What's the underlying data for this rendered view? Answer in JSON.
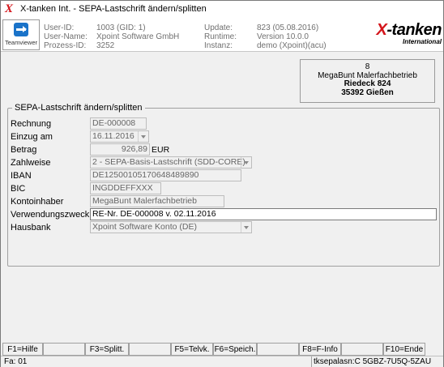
{
  "window": {
    "app_icon": "x-tanken-logo-icon",
    "app_icon_glyph": "X",
    "title": "X-tanken Int. - SEPA-Lastschrift ändern/splitten"
  },
  "header": {
    "teamviewer_label": "Teamviewer",
    "user_id_label": "User-ID:",
    "user_name_label": "User-Name:",
    "process_id_label": "Prozess-ID:",
    "user_id": "1003 (GID: 1)",
    "user_name": "Xpoint Software GmbH",
    "process_id": "3252",
    "update_label": "Update:",
    "runtime_label": "Runtime:",
    "instance_label": "Instanz:",
    "update": "823 (05.08.2016)",
    "runtime": "Version 10.0.0",
    "instance": "demo (Xpoint)(acu)",
    "brand_x": "X",
    "brand_rest": "-tanken",
    "brand_sub": "International"
  },
  "address": {
    "number": "8",
    "name": "MegaBunt Malerfachbetrieb",
    "street": "Riedeck 824",
    "city": "35392 Gießen"
  },
  "form": {
    "legend": "SEPA-Lastschrift ändern/splitten",
    "labels": {
      "rechnung": "Rechnung",
      "einzug": "Einzug am",
      "betrag": "Betrag",
      "zahlweise": "Zahlweise",
      "iban": "IBAN",
      "bic": "BIC",
      "kontoinhaber": "Kontoinhaber",
      "verwendungszweck": "Verwendungszweck",
      "hausbank": "Hausbank"
    },
    "values": {
      "rechnung": "DE-000008",
      "einzug": "16.11.2016",
      "betrag": "926,89",
      "currency": "EUR",
      "zahlweise": "2 - SEPA-Basis-Lastschrift (SDD-CORE)",
      "iban": "DE12500105170648489890",
      "bic": "INGDDEFFXXX",
      "kontoinhaber": "MegaBunt Malerfachbetrieb",
      "verwendungszweck": "RE-Nr. DE-000008 v. 02.11.2016",
      "hausbank": "Xpoint Software Konto (DE)"
    }
  },
  "fkeys": {
    "f1": "F1=Hilfe",
    "f3": "F3=Splitt.",
    "f5": "F5=Telvk.",
    "f6": "F6=Speich.",
    "f8": "F8=F-Info",
    "f10": "F10=Ende"
  },
  "status": {
    "left": "Fa: 01",
    "right": "tksepalasn:C 5GBZ-7U5Q-5ZAU"
  }
}
